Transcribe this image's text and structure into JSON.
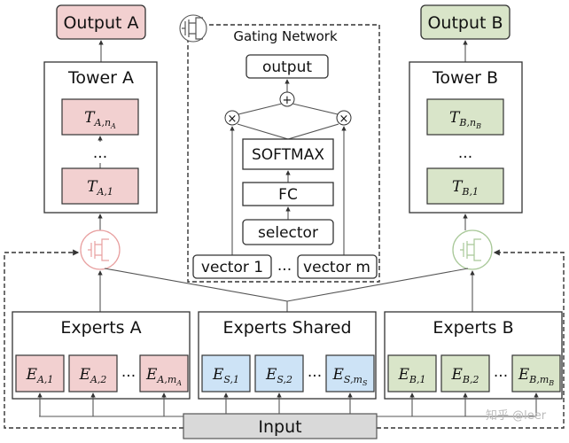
{
  "colors": {
    "task_a": "#f2d0d0",
    "task_b": "#d9e5c9",
    "shared": "#cde3f6",
    "input": "#d9d9d9"
  },
  "output_a": "Output A",
  "output_b": "Output B",
  "tower_a": {
    "title": "Tower A",
    "top": {
      "main": "T",
      "sub": "A,n",
      "subsub": "A"
    },
    "ellipsis": "...",
    "bottom": {
      "main": "T",
      "sub": "A,1"
    }
  },
  "tower_b": {
    "title": "Tower B",
    "top": {
      "main": "T",
      "sub": "B,n",
      "subsub": "B"
    },
    "ellipsis": "...",
    "bottom": {
      "main": "T",
      "sub": "B,1"
    }
  },
  "gating": {
    "title": "Gating Network",
    "output": "output",
    "plus": "+",
    "times": "×",
    "softmax": "SOFTMAX",
    "fc": "FC",
    "selector": "selector",
    "vector_1": "vector 1",
    "ellipsis": "...",
    "vector_m": "vector m"
  },
  "experts_a": {
    "title": "Experts A",
    "items": [
      {
        "main": "E",
        "sub": "A,1"
      },
      {
        "main": "E",
        "sub": "A,2"
      },
      {
        "main": "E",
        "sub": "A,m",
        "subsub": "A"
      }
    ],
    "ellipsis": "..."
  },
  "experts_shared": {
    "title": "Experts Shared",
    "items": [
      {
        "main": "E",
        "sub": "S,1"
      },
      {
        "main": "E",
        "sub": "S,2"
      },
      {
        "main": "E",
        "sub": "S,m",
        "subsub": "S"
      }
    ],
    "ellipsis": "..."
  },
  "experts_b": {
    "title": "Experts B",
    "items": [
      {
        "main": "E",
        "sub": "B,1"
      },
      {
        "main": "E",
        "sub": "B,2"
      },
      {
        "main": "E",
        "sub": "B,m",
        "subsub": "B"
      }
    ],
    "ellipsis": "..."
  },
  "input": "Input",
  "watermark": "知乎 @leer"
}
